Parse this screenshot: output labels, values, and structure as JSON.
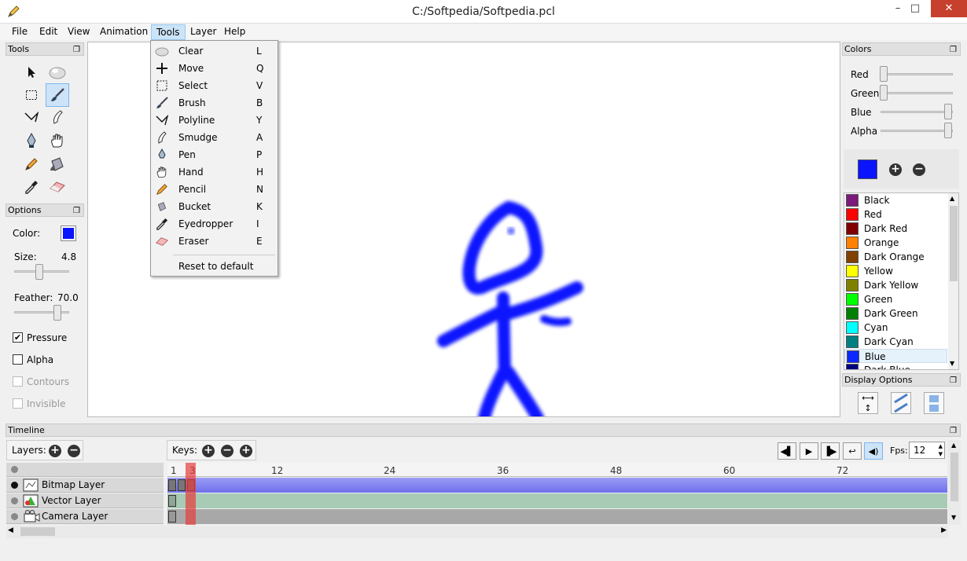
{
  "window": {
    "title": "C:/Softpedia/Softpedia.pcl",
    "minimize": "–",
    "maximize": "□",
    "close": "✕"
  },
  "menubar": [
    "File",
    "Edit",
    "View",
    "Animation",
    "Tools",
    "Layer",
    "Help"
  ],
  "tools_panel": {
    "title": "Tools",
    "float_icon": "❐"
  },
  "options_panel": {
    "title": "Options",
    "color_label": "Color:",
    "color_value": "#0a14ff",
    "size_label": "Size:",
    "size_value": "4.8",
    "feather_label": "Feather:",
    "feather_value": "70.0",
    "pressure_label": "Pressure",
    "alpha_label": "Alpha",
    "contours_label": "Contours",
    "invisible_label": "Invisible",
    "check_mark": "✔"
  },
  "tools_menu": {
    "items": [
      {
        "label": "Clear",
        "key": "L",
        "icon": "clear-icon"
      },
      {
        "label": "Move",
        "key": "Q",
        "icon": "move-icon"
      },
      {
        "label": "Select",
        "key": "V",
        "icon": "select-icon"
      },
      {
        "label": "Brush",
        "key": "B",
        "icon": "brush-icon"
      },
      {
        "label": "Polyline",
        "key": "Y",
        "icon": "polyline-icon"
      },
      {
        "label": "Smudge",
        "key": "A",
        "icon": "smudge-icon"
      },
      {
        "label": "Pen",
        "key": "P",
        "icon": "pen-icon"
      },
      {
        "label": "Hand",
        "key": "H",
        "icon": "hand-icon"
      },
      {
        "label": "Pencil",
        "key": "N",
        "icon": "pencil-icon"
      },
      {
        "label": "Bucket",
        "key": "K",
        "icon": "bucket-icon"
      },
      {
        "label": "Eyedropper",
        "key": "I",
        "icon": "eyedropper-icon"
      },
      {
        "label": "Eraser",
        "key": "E",
        "icon": "eraser-icon"
      }
    ],
    "reset": "Reset to default"
  },
  "colors_panel": {
    "title": "Colors",
    "red_label": "Red",
    "green_label": "Green",
    "blue_label": "Blue",
    "alpha_label": "Alpha",
    "current_color": "#0a14ff",
    "add_icon": "+",
    "remove_icon": "−",
    "swatches": [
      {
        "name": "Black",
        "color": "#7b1a7b"
      },
      {
        "name": "Red",
        "color": "#ff0000"
      },
      {
        "name": "Dark Red",
        "color": "#800000"
      },
      {
        "name": "Orange",
        "color": "#ff8000"
      },
      {
        "name": "Dark Orange",
        "color": "#804000"
      },
      {
        "name": "Yellow",
        "color": "#ffff00"
      },
      {
        "name": "Dark Yellow",
        "color": "#808000"
      },
      {
        "name": "Green",
        "color": "#00ff00"
      },
      {
        "name": "Dark Green",
        "color": "#008000"
      },
      {
        "name": "Cyan",
        "color": "#00ffff"
      },
      {
        "name": "Dark Cyan",
        "color": "#008080"
      },
      {
        "name": "Blue",
        "color": "#0a28ff"
      },
      {
        "name": "Dark Blue",
        "color": "#000080"
      }
    ]
  },
  "display_options": {
    "title": "Display Options"
  },
  "timeline": {
    "title": "Timeline",
    "layers_label": "Layers:",
    "keys_label": "Keys:",
    "fps_label": "Fps:",
    "fps_value": "12",
    "ruler": [
      "1",
      "3",
      "12",
      "24",
      "36",
      "48",
      "60",
      "72"
    ],
    "layers": [
      {
        "name": "Bitmap Layer",
        "icon": "bitmap-layer-icon"
      },
      {
        "name": "Vector Layer",
        "icon": "vector-layer-icon"
      },
      {
        "name": "Camera Layer",
        "icon": "camera-layer-icon"
      }
    ]
  }
}
